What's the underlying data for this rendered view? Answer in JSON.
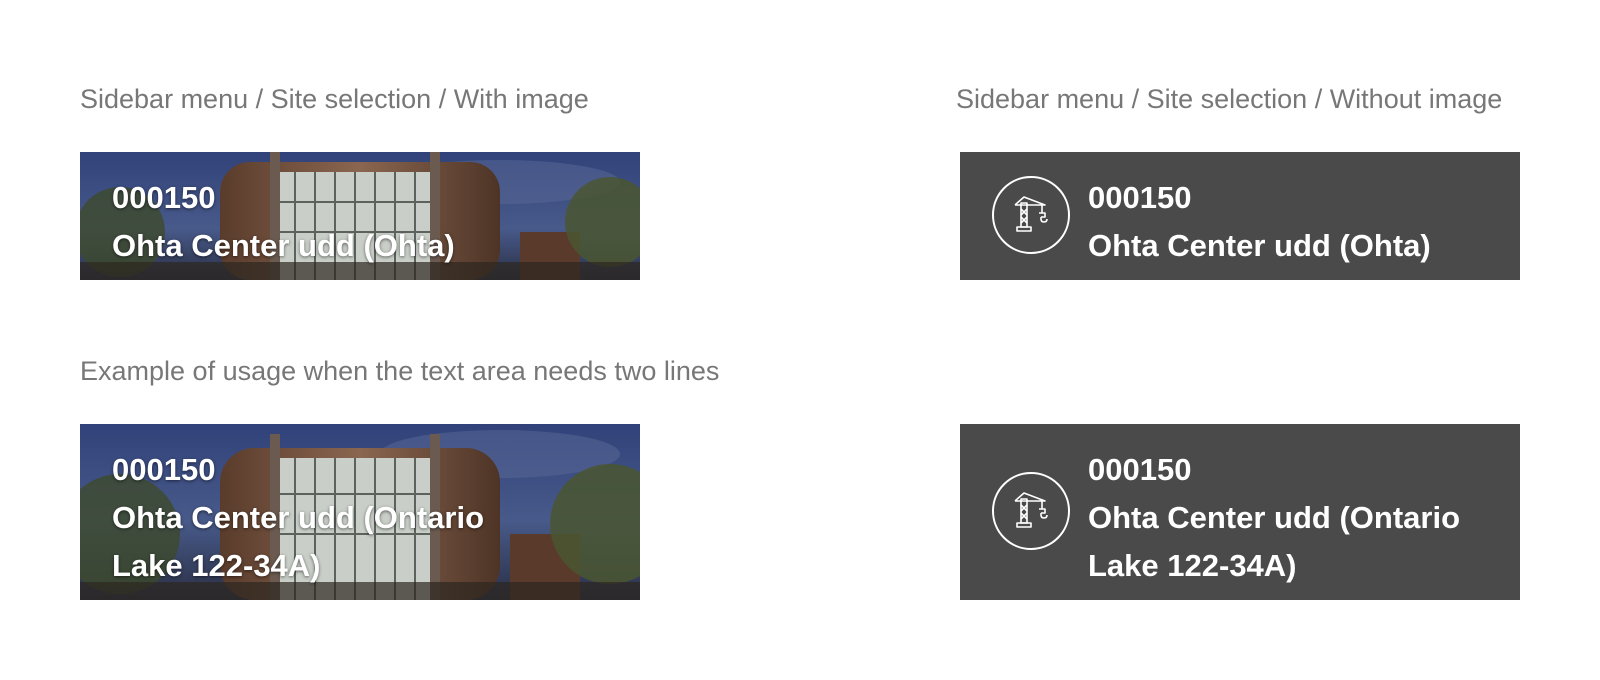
{
  "captions": {
    "with_image": "Sidebar menu / Site selection / With image",
    "without_image": "Sidebar menu / Site selection / Without image",
    "two_lines": "Example of usage when the text area needs two lines"
  },
  "cards": {
    "photo_single": {
      "code": "000150",
      "name": "Ohta Center udd (Ohta)"
    },
    "dark_single": {
      "code": "000150",
      "name": "Ohta Center udd (Ohta)",
      "icon": "crane-icon"
    },
    "photo_double": {
      "code": "000150",
      "name": "Ohta Center udd (Ontario Lake 122-34A)"
    },
    "dark_double": {
      "code": "000150",
      "name": "Ohta Center udd (Ontario Lake 122-34A)",
      "icon": "crane-icon"
    }
  },
  "colors": {
    "caption": "#777777",
    "dark_card": "#4a4a4a",
    "card_text": "#ffffff"
  }
}
